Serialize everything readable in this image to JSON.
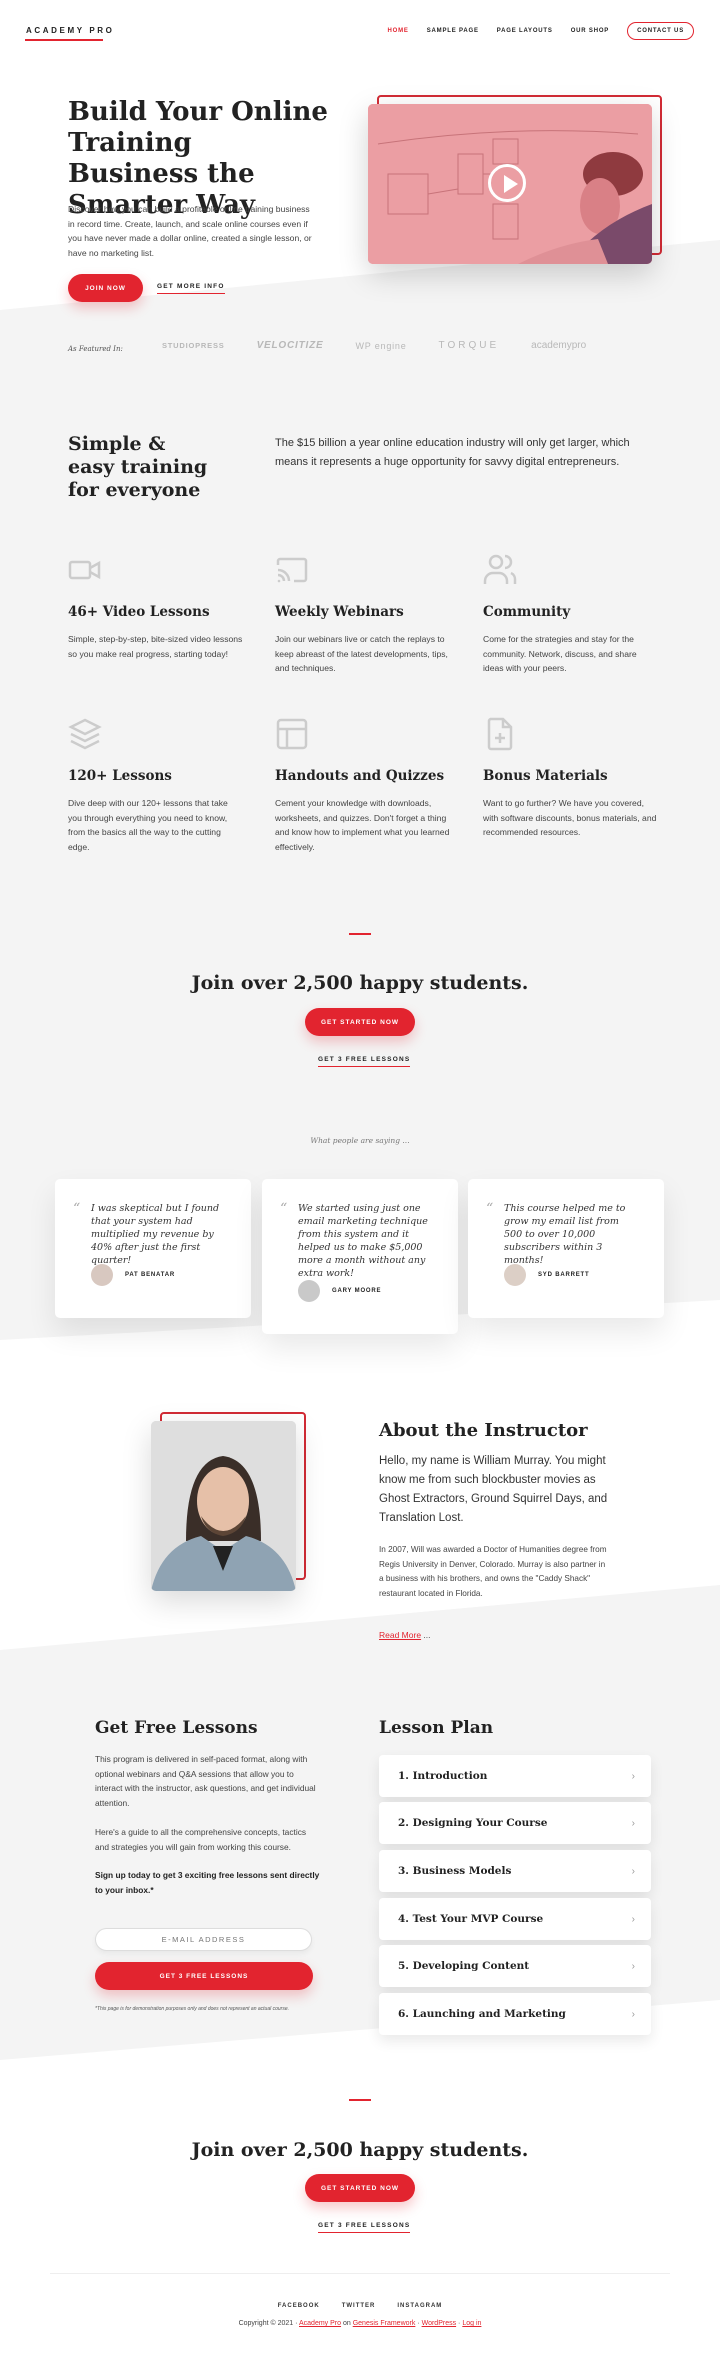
{
  "header": {
    "logo": "ACADEMY PRO",
    "nav": [
      {
        "label": "HOME",
        "active": true
      },
      {
        "label": "SAMPLE PAGE"
      },
      {
        "label": "PAGE LAYOUTS"
      },
      {
        "label": "OUR SHOP"
      }
    ],
    "contact_label": "CONTACT US"
  },
  "hero": {
    "title": "Build Your Online Training Business the Smarter Way",
    "text": "Discover how you can build a profitable online training business in record time. Create, launch, and scale online courses even if you have never made a dollar online, created a single lesson, or have no marketing list.",
    "join_label": "JOIN NOW",
    "more_label": "GET MORE INFO",
    "video_icon": "play-icon"
  },
  "featured": {
    "label": "As Featured In:",
    "logos": [
      "STUDIOPRESS",
      "VELOCITIZE",
      "WP engine",
      "TORQUE",
      "academypro"
    ]
  },
  "intro": {
    "title": "Simple & easy training for everyone",
    "text": "The $15 billion a year online education industry will only get larger, which means it represents a huge opportunity for savvy digital entrepreneurs."
  },
  "features": [
    {
      "icon": "video-icon",
      "title": "46+ Video Lessons",
      "text": "Simple, step-by-step, bite-sized video lessons so you make real progress, starting today!"
    },
    {
      "icon": "cast-icon",
      "title": "Weekly Webinars",
      "text": "Join our webinars live or catch the replays to keep abreast of the latest developments, tips, and techniques."
    },
    {
      "icon": "users-icon",
      "title": "Community",
      "text": "Come for the strategies and stay for the community. Network, discuss, and share ideas with your peers."
    },
    {
      "icon": "layers-icon",
      "title": "120+ Lessons",
      "text": "Dive deep with our 120+ lessons that take you through everything you need to know, from the basics all the way to the cutting edge."
    },
    {
      "icon": "layout-icon",
      "title": "Handouts and Quizzes",
      "text": "Cement your knowledge with downloads, worksheets, and quizzes. Don't forget a thing and know how to implement what you learned effectively."
    },
    {
      "icon": "file-plus-icon",
      "title": "Bonus Materials",
      "text": "Want to go further? We have you covered, with software discounts, bonus materials, and recommended resources."
    }
  ],
  "cta": {
    "title": "Join over 2,500 happy students.",
    "button": "GET STARTED NOW",
    "link": "GET 3 FREE LESSONS"
  },
  "testimonials": {
    "heading": "What people are saying ...",
    "items": [
      {
        "quote": "I was skeptical but I found that your system had multiplied my revenue by 40% after just the first quarter!",
        "name": "PAT BENATAR"
      },
      {
        "quote": "We started using just one email marketing technique from this system and it helped us to make $5,000 more a month without any extra work!",
        "name": "GARY MOORE"
      },
      {
        "quote": "This course helped me to grow my email list from 500 to over 10,000 subscribers within 3 months!",
        "name": "SYD BARRETT"
      }
    ]
  },
  "about": {
    "title": "About the Instructor",
    "lead": "Hello, my name is William Murray. You might know me from such blockbuster movies as Ghost Extractors, Ground Squirrel Days, and Translation Lost.",
    "text": "In 2007, Will was awarded a Doctor of Humanities degree from Regis University in Denver, Colorado. Murray is also partner in a business with his brothers, and owns the \"Caddy Shack\" restaurant located in Florida.",
    "read_more": "Read More",
    "ellipsis": " ..."
  },
  "free_lessons": {
    "title": "Get Free Lessons",
    "p1": "This program is delivered in self-paced format, along with optional webinars and Q&A sessions that allow you to interact with the instructor, ask questions, and get individual attention.",
    "p2": "Here's a guide to all the comprehensive concepts, tactics and strategies you will gain from working this course.",
    "p3": "Sign up today to get 3 exciting free lessons sent directly to your inbox.*",
    "email_placeholder": "E-MAIL ADDRESS",
    "button": "GET 3 FREE LESSONS",
    "disclaimer": "*This page is for demonstration purposes only and does not represent an actual course."
  },
  "lesson_plan": {
    "title": "Lesson Plan",
    "items": [
      "1. Introduction",
      "2. Designing Your Course",
      "3. Business Models",
      "4. Test Your MVP Course",
      "5. Developing Content",
      "6. Launching and Marketing"
    ]
  },
  "footer": {
    "links": [
      "FACEBOOK",
      "TWITTER",
      "INSTAGRAM"
    ],
    "copy_prefix": "Copyright © 2021 · ",
    "site": "Academy Pro",
    "on": " on ",
    "framework": "Genesis Framework",
    "sep1": " · ",
    "wp": "WordPress",
    "sep2": " · ",
    "login": "Log in"
  },
  "colors": {
    "accent": "#e2242f",
    "bg_gray": "#f4f4f4",
    "text": "#222222"
  }
}
